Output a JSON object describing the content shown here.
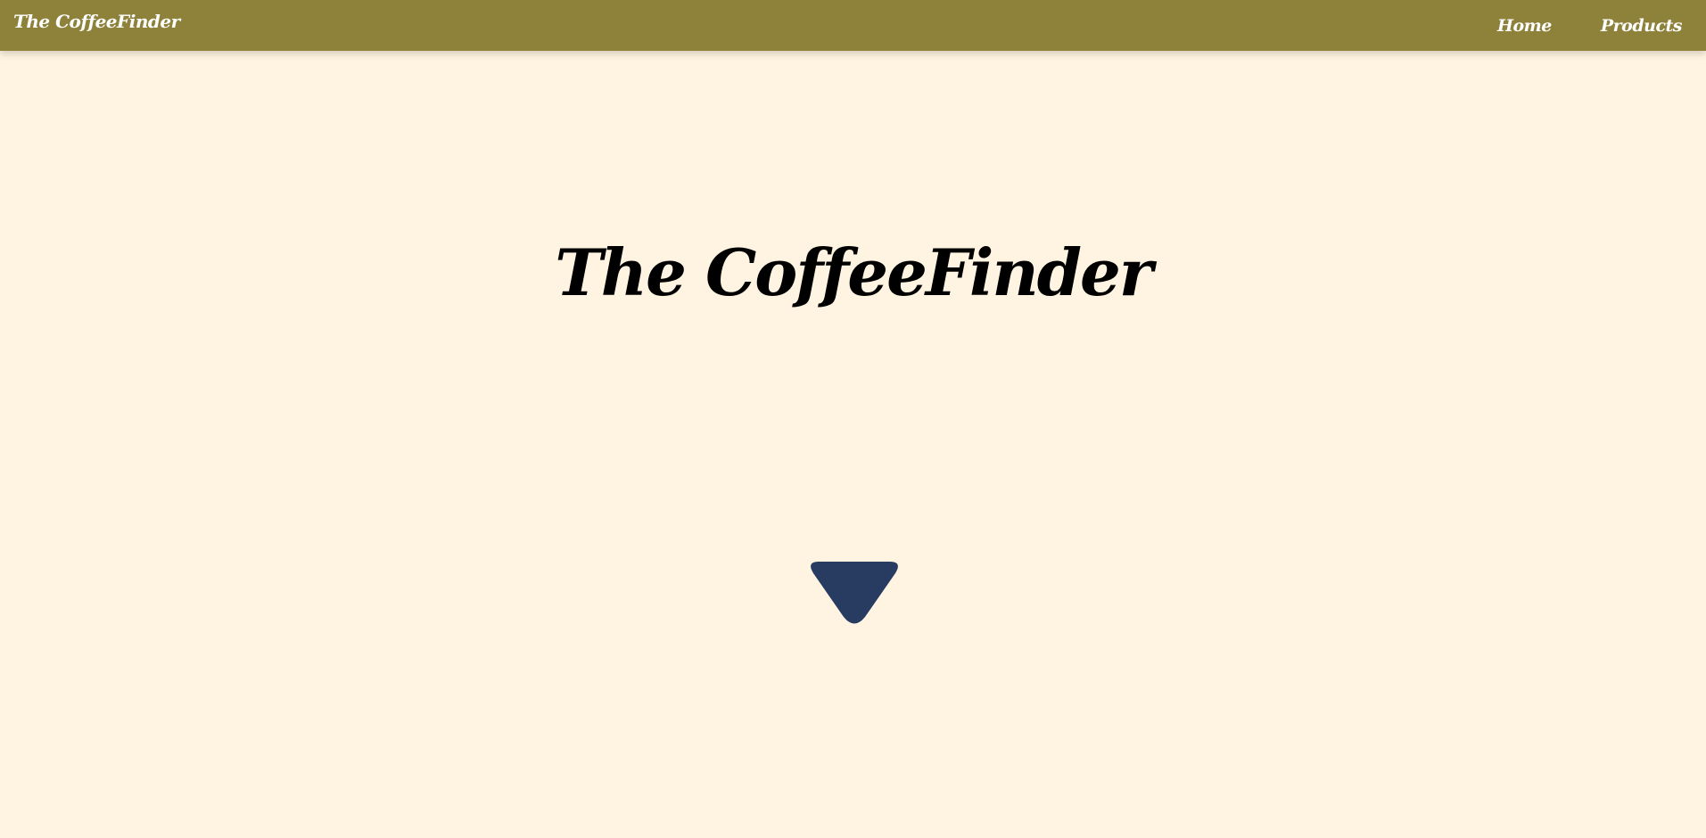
{
  "navbar": {
    "brand": "The CoffeeFinder",
    "links": [
      {
        "label": "Home"
      },
      {
        "label": "Products"
      }
    ],
    "background_color": "#8e823b"
  },
  "hero": {
    "title": "The CoffeeFinder",
    "scroll_icon": "triangle-down-icon",
    "arrow_color": "#283c62",
    "background_color": "#fff4e1"
  }
}
